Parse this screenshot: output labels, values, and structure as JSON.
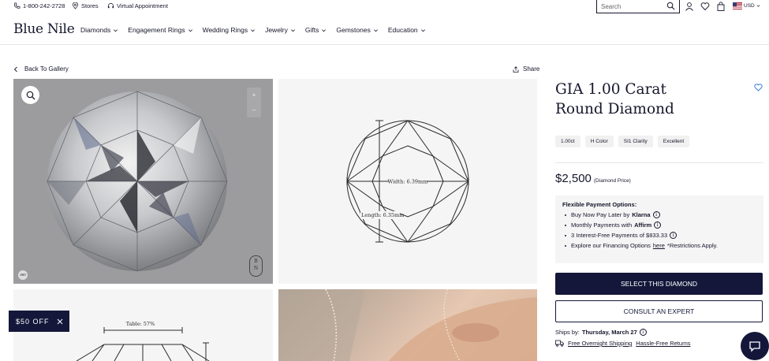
{
  "utility_bar": {
    "phone": "1-800-242-2728",
    "stores": "Stores",
    "virtual": "Virtual Appointment"
  },
  "search": {
    "placeholder": "Search"
  },
  "currency": "USD",
  "brand": {
    "logo": "Blue Nile"
  },
  "nav": {
    "items": [
      "Diamonds",
      "Engagement Rings",
      "Wedding Rings",
      "Jewelry",
      "Gifts",
      "Gemstones",
      "Education"
    ]
  },
  "back_link": "Back To Gallery",
  "share_label": "Share",
  "diagram": {
    "width_label": "Width: 6.39mm",
    "length_label": "Length: 6.35mm",
    "table_label": "Table: 57%"
  },
  "badge_360": "360",
  "bn_mark": {
    "top": "B",
    "bottom": "N"
  },
  "zoom": {
    "plus": "+",
    "minus": "–"
  },
  "product": {
    "title": "GIA 1.00 Carat Round Diamond",
    "chips": [
      "1.00ct",
      "H Color",
      "SI1 Clarity",
      "Excellent"
    ],
    "price": "$2,500",
    "price_note": "(Diamond Price)"
  },
  "payment": {
    "title": "Flexible Payment Options:",
    "line1_text": "Buy Now Pay Later by",
    "line1_brand": "Klarna",
    "line2_text": "Monthly Payments with",
    "line2_brand": "Affirm",
    "line3_text": "3 Interest-Free Payments of $833.33",
    "line4_text": "Explore our Financing Options",
    "line4_link": "here",
    "line4_tail": "*Restrictions Apply.",
    "info_glyph": "i"
  },
  "actions": {
    "select": "SELECT THIS DIAMOND",
    "consult": "CONSULT AN EXPERT"
  },
  "shipping": {
    "ships_by_label": "Ships by:",
    "ships_by_date": "Thursday, March 27",
    "overnight": "Free Overnight Shipping",
    "returns": "Hassle-Free Returns"
  },
  "promo": {
    "label": "$50 OFF"
  },
  "colors": {
    "navy": "#14173a",
    "panel_gray": "#f5f5f5"
  }
}
